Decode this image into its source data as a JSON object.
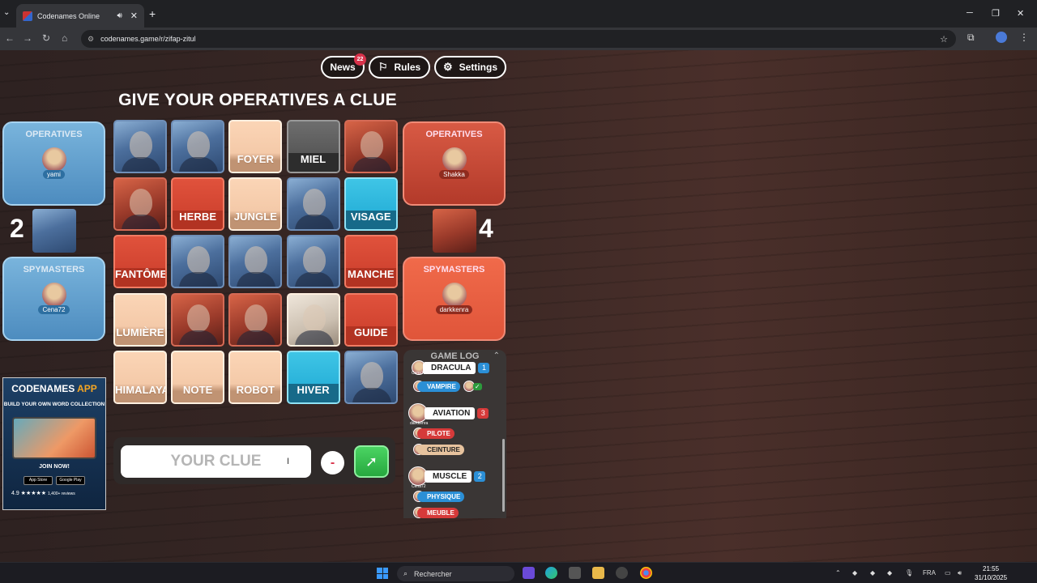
{
  "browser": {
    "tab_title": "Codenames Online",
    "url": "codenames.game/r/zifap-zitul",
    "new_tab": "+",
    "minimize": "─",
    "restore": "❐",
    "close": "✕"
  },
  "topnav": {
    "news": "News",
    "news_count": "22",
    "rules": "Rules",
    "settings": "Settings"
  },
  "heading": "GIVE YOUR OPERATIVES A CLUE",
  "blue_team": {
    "operatives_label": "OPERATIVES",
    "operative_name": "yami",
    "remaining": "2",
    "spymasters_label": "SPYMASTERS",
    "spymaster_name": "Cena72"
  },
  "red_team": {
    "operatives_label": "OPERATIVES",
    "operative_name": "Shakka",
    "remaining": "4",
    "spymasters_label": "SPYMASTERS",
    "spymaster_name": "darkkenra"
  },
  "board": [
    {
      "word": "",
      "color": "blueimg"
    },
    {
      "word": "",
      "color": "blueimg"
    },
    {
      "word": "FOYER",
      "color": "beige"
    },
    {
      "word": "MIEL",
      "color": "gray"
    },
    {
      "word": "",
      "color": "redimg"
    },
    {
      "word": "",
      "color": "redimg"
    },
    {
      "word": "HERBE",
      "color": "red"
    },
    {
      "word": "JUNGLE",
      "color": "beige"
    },
    {
      "word": "",
      "color": "blueimg"
    },
    {
      "word": "VISAGE",
      "color": "cyan"
    },
    {
      "word": "FANTÔME",
      "color": "red"
    },
    {
      "word": "",
      "color": "blueimg"
    },
    {
      "word": "",
      "color": "blueimg"
    },
    {
      "word": "",
      "color": "blueimg"
    },
    {
      "word": "MANCHE",
      "color": "red"
    },
    {
      "word": "LUMIÈRE",
      "color": "beige"
    },
    {
      "word": "",
      "color": "redimg"
    },
    {
      "word": "",
      "color": "redimg"
    },
    {
      "word": "",
      "color": "beigeimg"
    },
    {
      "word": "GUIDE",
      "color": "red"
    },
    {
      "word": "HIMALAYA",
      "color": "beige"
    },
    {
      "word": "NOTE",
      "color": "beige"
    },
    {
      "word": "ROBOT",
      "color": "beige"
    },
    {
      "word": "HIVER",
      "color": "cyan"
    },
    {
      "word": "",
      "color": "blueimg"
    }
  ],
  "clue_input": {
    "placeholder": "YOUR CLUE",
    "count": "-"
  },
  "app_ad": {
    "title_a": "CODENAMES",
    "title_b": "APP",
    "subtitle": "BUILD YOUR OWN WORD COLLECTION",
    "join": "JOIN NOW!",
    "app_store": "App Store",
    "google_play": "Google Play",
    "rating": "4.9 ★★★★★",
    "reviews": "1,400+ reviews"
  },
  "game_log": {
    "title": "GAME LOG",
    "entries": [
      {
        "clue": "DRACULA",
        "number": "1",
        "player": "Cena72",
        "team": "blue"
      },
      {
        "clue": "AVIATION",
        "number": "3",
        "player": "darkkenra",
        "team": "red"
      },
      {
        "clue": "MUSCLE",
        "number": "2",
        "player": "Cena72",
        "team": "blue"
      }
    ],
    "guesses": [
      {
        "word": "VAMPIRE",
        "type": "blue"
      },
      {
        "word": "PILOTE",
        "type": "red"
      },
      {
        "word": "CEINTURE",
        "type": "beige"
      },
      {
        "word": "PHYSIQUE",
        "type": "blue"
      },
      {
        "word": "MEUBLE",
        "type": "red"
      }
    ]
  },
  "taskbar": {
    "search": "Rechercher",
    "lang": "FRA",
    "time": "21:55",
    "date": "31/10/2025"
  },
  "colors": {
    "blue_team": "#4d8cbf",
    "red_team": "#c93c2a",
    "neutral": "#f0c3a1",
    "assassin": "#4b4b4b",
    "revealed_blue": "#1da8d3",
    "submit_green": "#27a83f"
  }
}
